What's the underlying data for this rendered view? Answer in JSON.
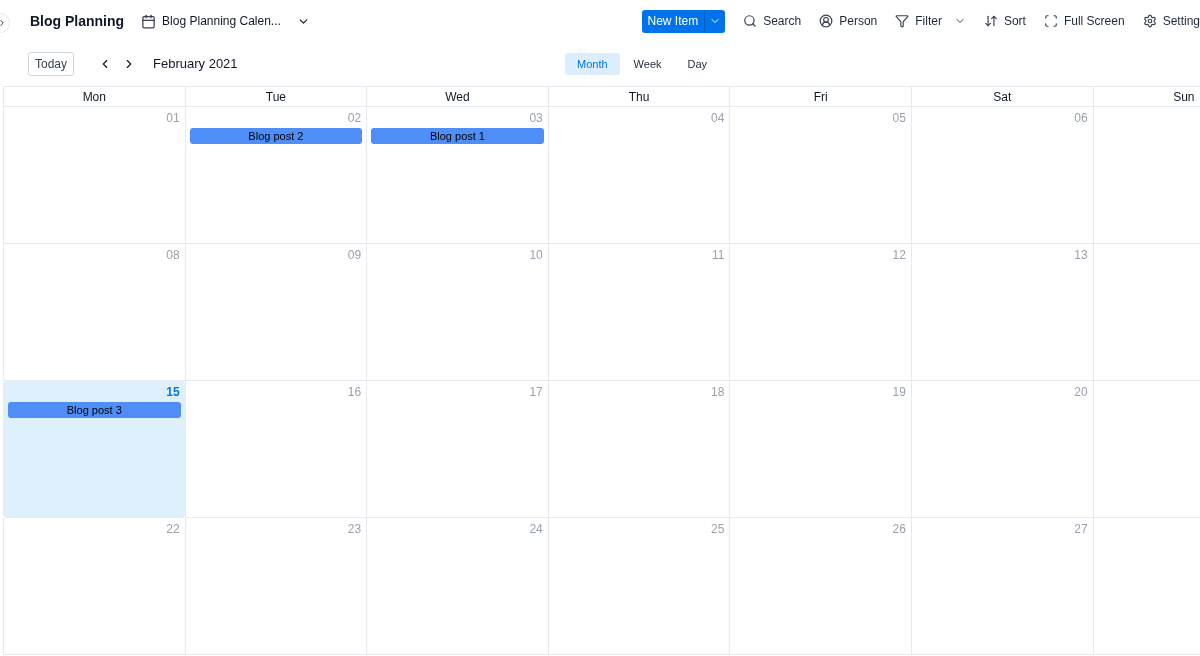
{
  "header": {
    "title": "Blog Planning",
    "view_selector": "Blog Planning Calen...",
    "new_item": "New Item",
    "tools": [
      {
        "kind": "search",
        "label": "Search"
      },
      {
        "kind": "person",
        "label": "Person"
      },
      {
        "kind": "filter",
        "label": "Filter"
      },
      {
        "kind": "sort",
        "label": "Sort"
      },
      {
        "kind": "fullscreen",
        "label": "Full Screen"
      },
      {
        "kind": "settings",
        "label": "Setting"
      }
    ]
  },
  "nav": {
    "today": "Today",
    "period": "February 2021",
    "views": [
      {
        "label": "Month",
        "selected": true
      },
      {
        "label": "Week",
        "selected": false
      },
      {
        "label": "Day",
        "selected": false
      }
    ]
  },
  "weekdays": [
    "Mon",
    "Tue",
    "Wed",
    "Thu",
    "Fri",
    "Sat",
    "Sun"
  ],
  "weeks": [
    {
      "days": [
        {
          "day": "01",
          "today": false
        },
        {
          "day": "02",
          "today": false,
          "events": [
            "Blog post 2"
          ]
        },
        {
          "day": "03",
          "today": false,
          "events": [
            "Blog post 1"
          ]
        },
        {
          "day": "04",
          "today": false
        },
        {
          "day": "05",
          "today": false
        },
        {
          "day": "06",
          "today": false
        },
        {
          "today": false
        }
      ]
    },
    {
      "days": [
        {
          "day": "08",
          "today": false
        },
        {
          "day": "09",
          "today": false
        },
        {
          "day": "10",
          "today": false
        },
        {
          "day": "11",
          "today": false
        },
        {
          "day": "12",
          "today": false
        },
        {
          "day": "13",
          "today": false
        },
        {
          "today": false
        }
      ]
    },
    {
      "days": [
        {
          "day": "15",
          "today": true,
          "events": [
            "Blog post 3"
          ]
        },
        {
          "day": "16",
          "today": false
        },
        {
          "day": "17",
          "today": false
        },
        {
          "day": "18",
          "today": false
        },
        {
          "day": "19",
          "today": false
        },
        {
          "day": "20",
          "today": false
        },
        {
          "today": false
        }
      ]
    },
    {
      "days": [
        {
          "day": "22",
          "today": false
        },
        {
          "day": "23",
          "today": false
        },
        {
          "day": "24",
          "today": false
        },
        {
          "day": "25",
          "today": false
        },
        {
          "day": "26",
          "today": false
        },
        {
          "day": "27",
          "today": false
        },
        {
          "today": false
        }
      ]
    }
  ]
}
